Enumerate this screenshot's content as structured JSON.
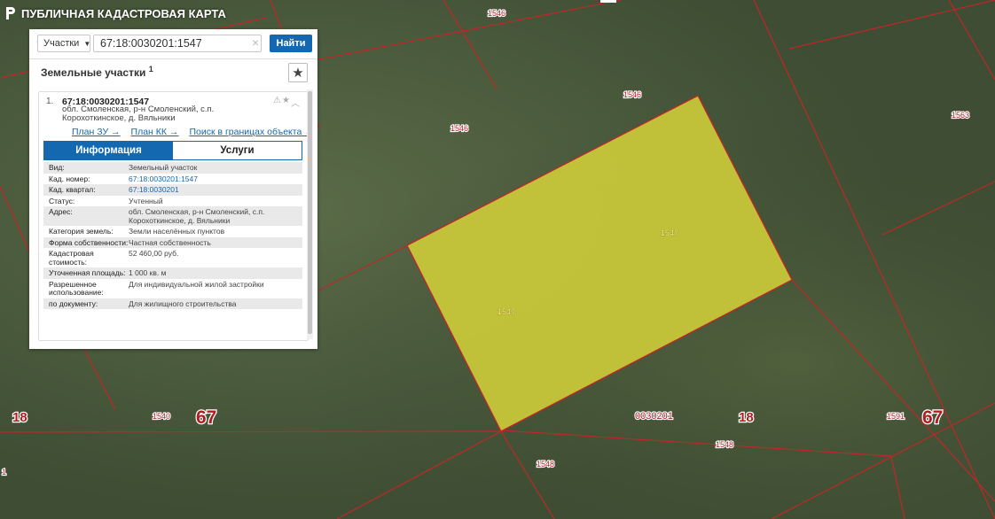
{
  "app": {
    "title": "ПУБЛИЧНАЯ КАДАСТРОВАЯ КАРТА"
  },
  "search": {
    "type_label": "Участки",
    "query": "67:18:0030201:1547",
    "button": "Найти"
  },
  "results": {
    "title": "Земельные участки",
    "count": "1",
    "item": {
      "number": "1.",
      "cad_number": "67:18:0030201:1547",
      "address": "обл. Смоленская, р-н Смоленский, с.п. Корохоткинское, д. Вяльники",
      "links": [
        "План ЗУ →",
        "План КК →",
        "Поиск в границах объекта →"
      ],
      "tabs": [
        "Информация",
        "Услуги"
      ],
      "info": [
        {
          "k": "Вид:",
          "v": "Земельный участок"
        },
        {
          "k": "Кад. номер:",
          "v": "67:18:0030201:1547"
        },
        {
          "k": "Кад. квартал:",
          "v": "67:18:0030201"
        },
        {
          "k": "Статус:",
          "v": "Учтенный"
        },
        {
          "k": "Адрес:",
          "v": "обл. Смоленская, р-н Смоленский, с.п. Корохоткинское, д. Вяльники"
        },
        {
          "k": "Категория земель:",
          "v": "Земли населённых пунктов"
        },
        {
          "k": "Форма собственности:",
          "v": "Частная собственность"
        },
        {
          "k": "Кадастровая стоимость:",
          "v": "52 460,00 руб."
        },
        {
          "k": "Уточненная площадь:",
          "v": "1 000 кв. м"
        },
        {
          "k": "Разрешенное использование:",
          "v": "Для индивидуальной жилой застройки"
        },
        {
          "k": "по документу:",
          "v": "Для жилищного строительства"
        }
      ]
    }
  },
  "map": {
    "parcel_labels": [
      "1546",
      "1546",
      "1546",
      "1563",
      "1547",
      "1547",
      "1540",
      "1548",
      "1548",
      "1591"
    ],
    "quarter_label": "0030201",
    "region_labels": [
      "67",
      "67"
    ],
    "district_labels": [
      "18",
      "18"
    ],
    "edge_label": "1",
    "colors": {
      "parcel_fill": "#d6d43a",
      "boundary": "#c0262a",
      "label_text": "#b01e24",
      "selected_label": "#f5f08a"
    }
  }
}
